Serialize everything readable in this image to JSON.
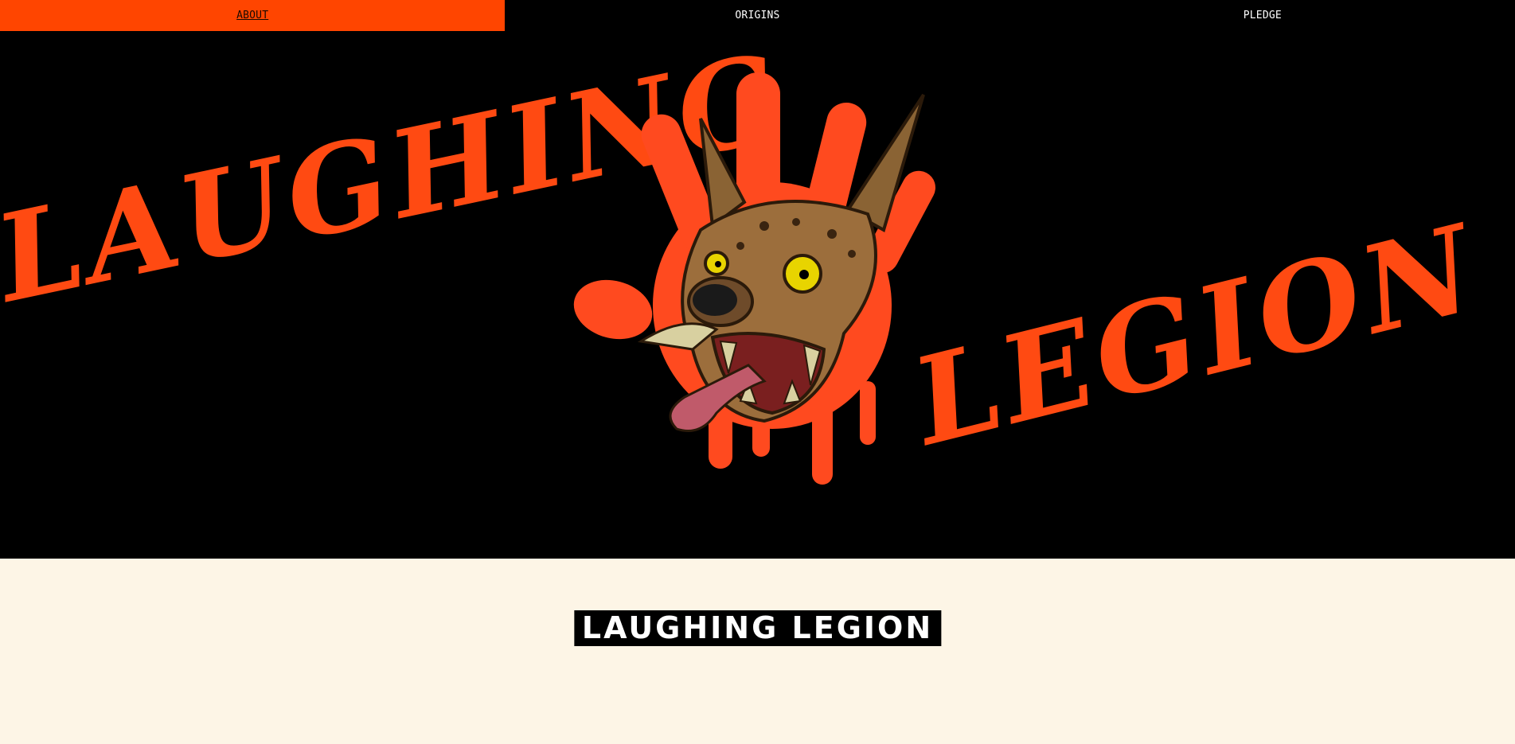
{
  "nav": {
    "items": [
      {
        "label": "ABOUT",
        "active": true
      },
      {
        "label": "ORIGINS",
        "active": false
      },
      {
        "label": "PLEDGE",
        "active": false
      }
    ]
  },
  "hero": {
    "logo_word_left": "LAUGHING",
    "logo_word_right": "LEGION",
    "illustration": "hyena-head-on-red-handprint",
    "accent_color": "#ff4500"
  },
  "about": {
    "title": "LAUGHING LEGION",
    "background_color": "#fdf5e6"
  }
}
